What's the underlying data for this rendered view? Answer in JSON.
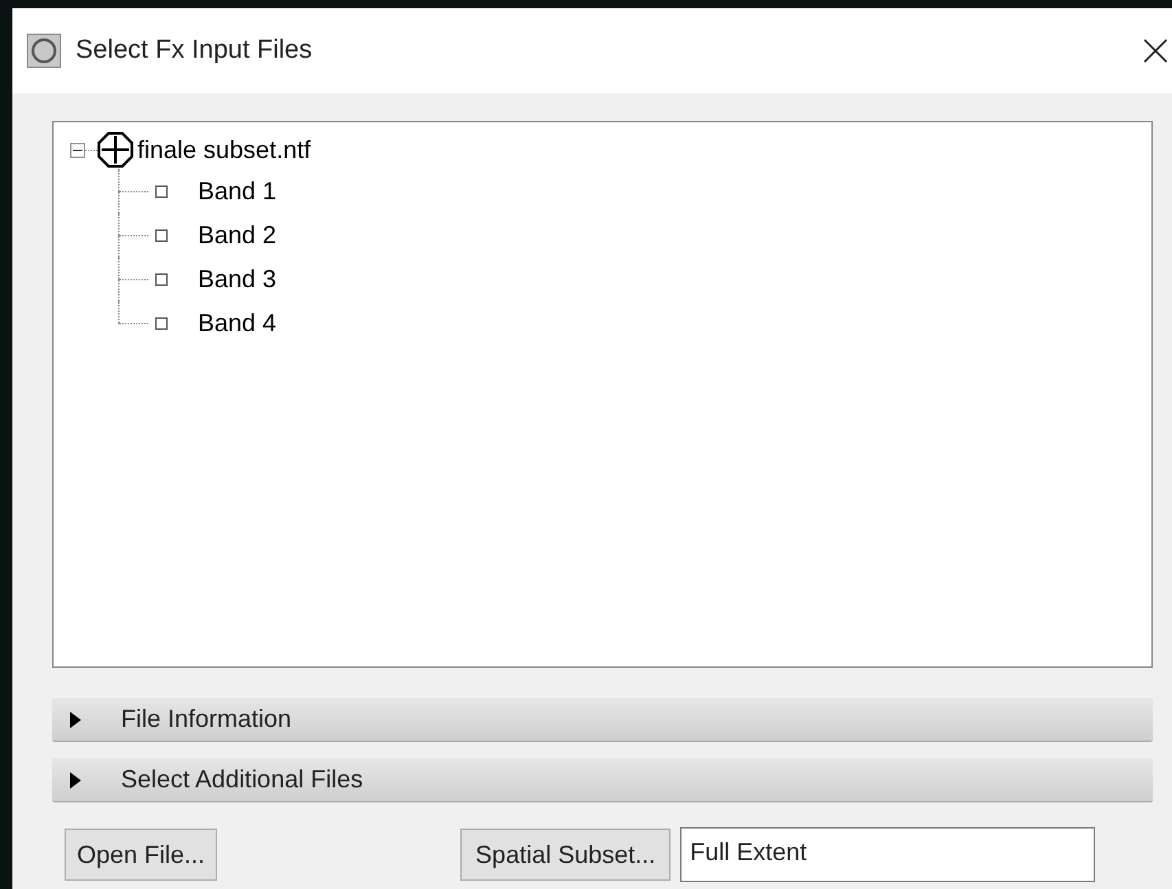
{
  "window": {
    "title": "Select Fx Input Files"
  },
  "tree": [
    {
      "label": "finale subset.ntf",
      "expanded": true,
      "children": [
        {
          "label": "Band 1",
          "checked": false
        },
        {
          "label": "Band 2",
          "checked": false
        },
        {
          "label": "Band 3",
          "checked": false
        },
        {
          "label": "Band 4",
          "checked": false
        }
      ]
    }
  ],
  "sections": [
    {
      "label": "File Information",
      "expanded": false
    },
    {
      "label": "Select Additional Files",
      "expanded": false
    }
  ],
  "buttons": {
    "open_file": "Open File...",
    "spatial_subset": "Spatial Subset..."
  },
  "subset_field": {
    "value": "Full Extent"
  }
}
